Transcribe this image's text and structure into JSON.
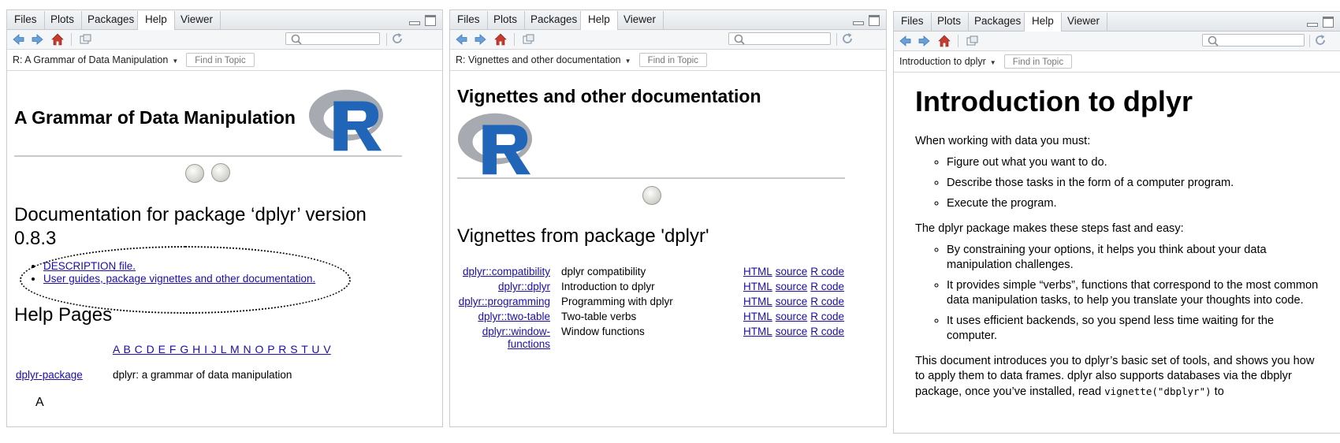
{
  "tabs": [
    "Files",
    "Plots",
    "Packages",
    "Help",
    "Viewer"
  ],
  "active_tab": "Help",
  "panes": [
    {
      "topic": "R: A Grammar of Data Manipulation",
      "find_placeholder": "Find in Topic",
      "title": "A Grammar of Data Manipulation",
      "doc_heading": "Documentation for package ‘dplyr’ version 0.8.3",
      "links": [
        "DESCRIPTION file.",
        "User guides, package vignettes and other documentation."
      ],
      "help_heading": "Help Pages",
      "alphabet": "A B C D E F G H I J L M N O P R S T U V",
      "package_link": "dplyr-package",
      "package_desc": "dplyr: a grammar of data manipulation",
      "cut_text": "A"
    },
    {
      "topic": "R: Vignettes and other documentation",
      "find_placeholder": "Find in Topic",
      "title": "Vignettes and other documentation",
      "sub_heading": "Vignettes from package 'dplyr'",
      "vignettes": [
        {
          "name": "dplyr::compatibility",
          "desc": "dplyr compatibility"
        },
        {
          "name": "dplyr::dplyr",
          "desc": "Introduction to dplyr"
        },
        {
          "name": "dplyr::programming",
          "desc": "Programming with dplyr"
        },
        {
          "name": "dplyr::two-table",
          "desc": "Two-table verbs"
        },
        {
          "name_line1": "dplyr::window-",
          "name_line2": "functions",
          "desc": "Window functions"
        }
      ],
      "link_labels": {
        "html": "HTML",
        "source": "source",
        "rcode": "R code"
      }
    },
    {
      "topic": "Introduction to dplyr",
      "find_placeholder": "Find in Topic",
      "title": "Introduction to dplyr",
      "intro": "When working with data you must:",
      "must_list": [
        "Figure out what you want to do.",
        "Describe those tasks in the form of a computer program.",
        "Execute the program."
      ],
      "easy_intro": "The dplyr package makes these steps fast and easy:",
      "easy_list": [
        "By constraining your options, it helps you think about your data manipulation challenges.",
        "It provides simple “verbs”, functions that correspond to the most common data manipulation tasks, to help you translate your thoughts into code.",
        "It uses efficient backends, so you spend less time waiting for the computer."
      ],
      "closing_pre": "This document introduces you to dplyr’s basic set of tools, and shows you how to apply them to data frames. dplyr also supports databases via the dbplyr package, once you’ve installed, read ",
      "closing_code": "vignette(\"dbplyr\")",
      "closing_post": " to"
    }
  ],
  "colors": {
    "link": "#1a0dab",
    "r_blue": "#2165b8",
    "r_gray": "#9aa0a6",
    "nav_arrow": "#6aa0d8",
    "home_red": "#c73b2f"
  }
}
